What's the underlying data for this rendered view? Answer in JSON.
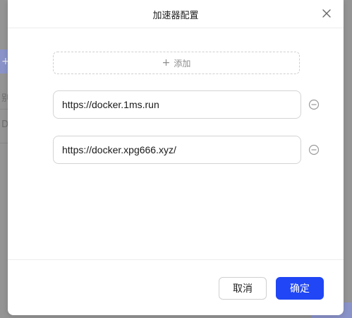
{
  "background": {
    "tab_glyph": "+",
    "text_1": "别",
    "text_2": "D"
  },
  "dialog": {
    "title": "加速器配置",
    "close_icon": "close-icon",
    "add_button": {
      "icon": "plus-icon",
      "label": "添加"
    },
    "mirrors": [
      {
        "value": "https://docker.1ms.run",
        "remove_icon": "minus-circle-icon"
      },
      {
        "value": "https://docker.xpg666.xyz/",
        "remove_icon": "minus-circle-icon"
      }
    ],
    "footer": {
      "cancel_label": "取消",
      "ok_label": "确定"
    }
  },
  "colors": {
    "primary": "#2046f5",
    "overlay": "#949494",
    "border": "#d4d4d4"
  }
}
